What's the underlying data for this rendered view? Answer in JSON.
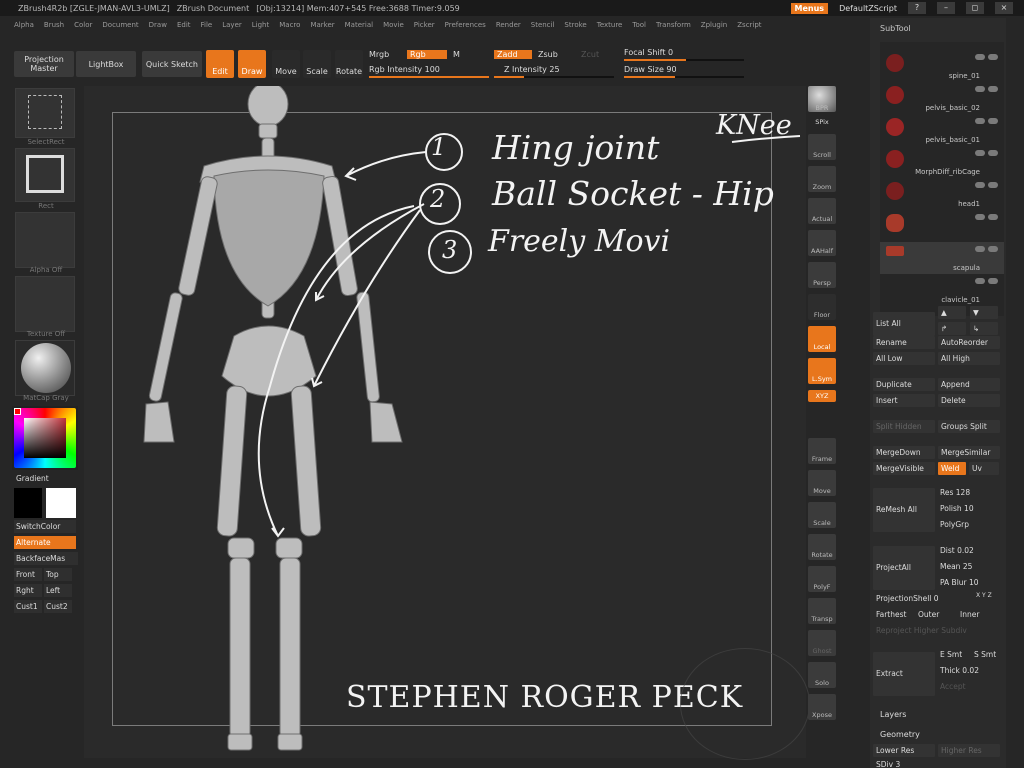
{
  "titlebar": {
    "items": [
      "ZBrush4R2b [ZGLE-JMAN-AVL3-UMLZ]",
      "ZBrush Document",
      "[Obj:13214] Mem:407+545 Free:3688 Timer:9.059"
    ],
    "menus": "Menus",
    "default_zscript": "DefaultZScript"
  },
  "menu": [
    "Alpha",
    "Brush",
    "Color",
    "Document",
    "Draw",
    "Edit",
    "File",
    "Layer",
    "Light",
    "Macro",
    "Marker",
    "Material",
    "Movie",
    "Picker",
    "Preferences",
    "Render",
    "Stencil",
    "Stroke",
    "Texture",
    "Tool",
    "Transform",
    "Zplugin",
    "Zscript"
  ],
  "toolbar": {
    "projection_master": "Projection Master",
    "lightbox": "LightBox",
    "quick_sketch": "Quick Sketch",
    "edit": "Edit",
    "draw": "Draw",
    "move": "Move",
    "scale": "Scale",
    "rotate": "Rotate",
    "mrgb": "Mrgb",
    "rgb": "Rgb",
    "m": "M",
    "rgb_intensity": "Rgb Intensity 100",
    "zadd": "Zadd",
    "zsub": "Zsub",
    "zcut": "Zcut",
    "z_intensity": "Z Intensity 25",
    "focal_shift": "Focal Shift 0",
    "draw_size": "Draw Size 90",
    "rgb_intensity_value": 100,
    "z_intensity_value": 25,
    "draw_size_value": 90
  },
  "left": {
    "selectrect": "SelectRect",
    "rect": "Rect",
    "alpha_off": "Alpha Off",
    "texture_off": "Texture Off",
    "matcap": "MatCap Gray",
    "gradient": "Gradient",
    "switchcolor": "SwitchColor",
    "alternate": "Alternate",
    "backfacemask": "BackfaceMas",
    "front": "Front",
    "top": "Top",
    "right": "Rght",
    "left_btn": "Left",
    "cust1": "Cust1",
    "cust2": "Cust2"
  },
  "right_shelf": [
    "BPR",
    "SPix",
    "Scroll",
    "Zoom",
    "Actual",
    "AAHalf",
    "Persp",
    "Floor",
    "Local",
    "L.Sym",
    "XYZ",
    "Frame",
    "Move",
    "Scale",
    "Rotate",
    "PolyF",
    "Transp",
    "Ghost",
    "Solo",
    "Xpose"
  ],
  "subtool": {
    "header": "SubTool",
    "items": [
      "spine_01",
      "pelvis_basic_02",
      "pelvis_basic_01",
      "MorphDiff_ribCage",
      "head1",
      "scapula",
      "clavicle_01"
    ]
  },
  "panel": {
    "list_all": "List All",
    "rename": "Rename",
    "autoreorder": "AutoReorder",
    "all_low": "All Low",
    "all_high": "All High",
    "duplicate": "Duplicate",
    "append": "Append",
    "insert": "Insert",
    "delete": "Delete",
    "split_hidden": "Split Hidden",
    "groups_split": "Groups Split",
    "mergedown": "MergeDown",
    "mergesimilar": "MergeSimilar",
    "mergevisible": "MergeVisible",
    "weld": "Weld",
    "uv": "Uv",
    "remesh_all": "ReMesh All",
    "res": "Res 128",
    "polish": "Polish 10",
    "polygrp": "PolyGrp",
    "projectall": "ProjectAll",
    "dist": "Dist 0.02",
    "mean": "Mean 25",
    "pa_blur": "PA Blur 10",
    "projectionshell": "ProjectionShell 0",
    "xyz": "X Y Z",
    "farthest": "Farthest",
    "outer": "Outer",
    "inner": "Inner",
    "reproject": "Reproject Higher Subdiv",
    "extract": "Extract",
    "e_smt": "E Smt",
    "s_smt": "S Smt",
    "thick": "Thick 0.02",
    "accept": "Accept",
    "layers": "Layers",
    "geometry": "Geometry",
    "lower_res": "Lower Res",
    "higher_res": "Higher Res",
    "sdiv": "SDiv 3"
  },
  "annotations": {
    "n1": "1",
    "n2": "2",
    "n3": "3",
    "line1": "Hing joint",
    "knee": "KNee",
    "line2": "Ball Socket - Hip",
    "line3": "Freely Movi",
    "signature": "STEPHEN ROGER PECK"
  }
}
